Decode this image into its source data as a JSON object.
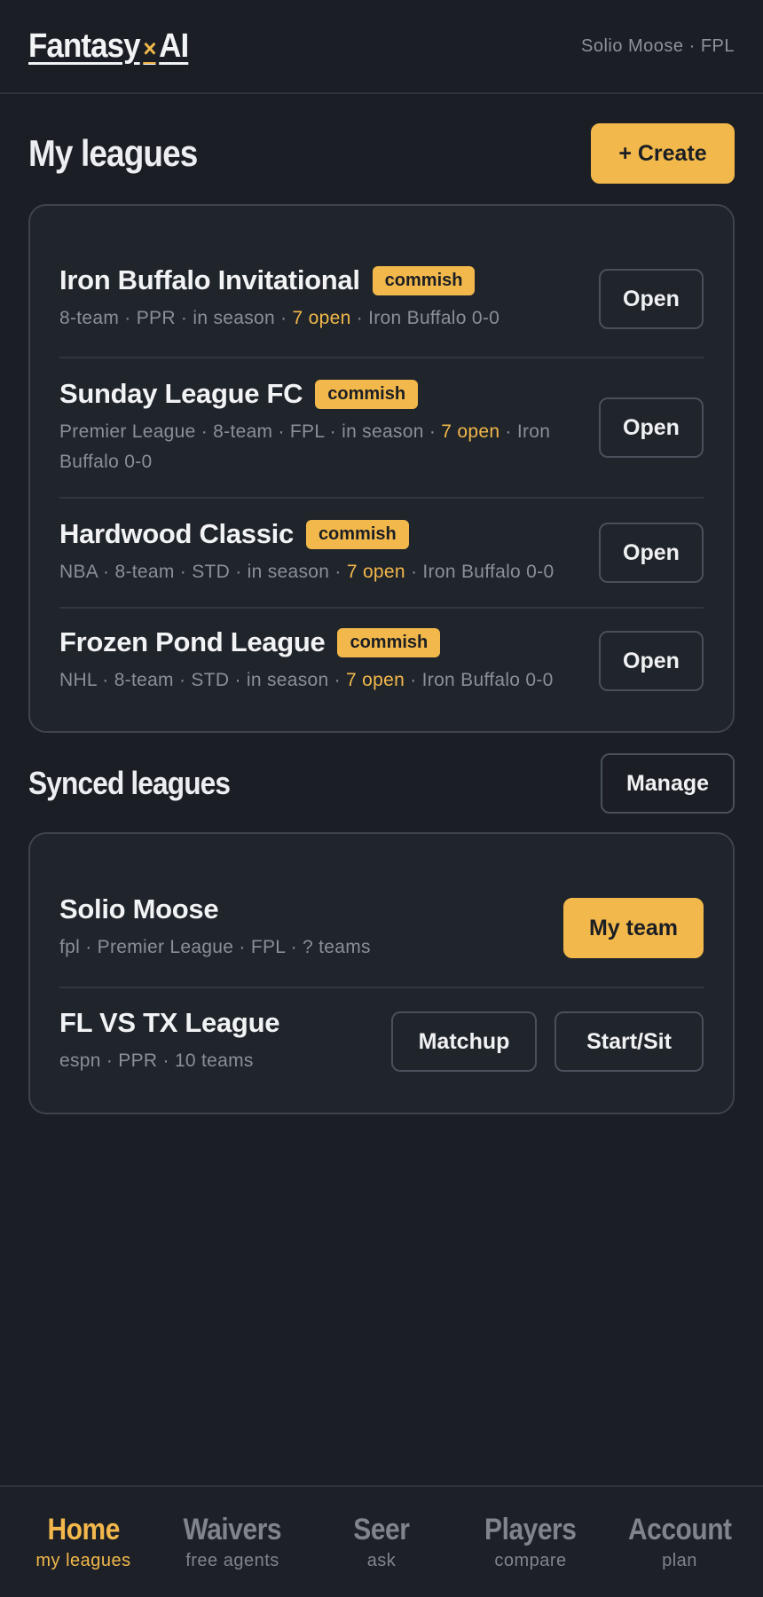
{
  "header": {
    "logo_left": "Fantasy",
    "logo_mark": "×",
    "logo_right": "AI",
    "account_meta": "Solio Moose · FPL"
  },
  "my_leagues": {
    "title": "My leagues",
    "create_label": "+ Create",
    "items": [
      {
        "name": "Iron Buffalo Invitational",
        "badge": "commish",
        "meta_before": "8-team · PPR · in season · ",
        "meta_highlight": "7 open",
        "meta_after": " · Iron Buffalo 0-0",
        "action": "Open"
      },
      {
        "name": "Sunday League FC",
        "badge": "commish",
        "meta_before": "Premier League · 8-team · FPL · in season · ",
        "meta_highlight": "7 open",
        "meta_after": " · Iron Buffalo 0-0",
        "action": "Open"
      },
      {
        "name": "Hardwood Classic",
        "badge": "commish",
        "meta_before": "NBA · 8-team · STD · in season · ",
        "meta_highlight": "7 open",
        "meta_after": " · Iron Buffalo 0-0",
        "action": "Open"
      },
      {
        "name": "Frozen Pond League",
        "badge": "commish",
        "meta_before": "NHL · 8-team · STD · in season · ",
        "meta_highlight": "7 open",
        "meta_after": " · Iron Buffalo 0-0",
        "action": "Open"
      }
    ]
  },
  "synced_leagues": {
    "title": "Synced leagues",
    "manage_label": "Manage",
    "items": [
      {
        "name": "Solio Moose",
        "meta": "fpl · Premier League · FPL · ? teams",
        "actions": [
          "My team"
        ]
      },
      {
        "name": "FL VS TX League",
        "meta": "espn · PPR · 10 teams",
        "actions": [
          "Matchup",
          "Start/Sit"
        ]
      }
    ]
  },
  "bottom_nav": [
    {
      "label": "Home",
      "sub": "my leagues",
      "active": true
    },
    {
      "label": "Waivers",
      "sub": "free agents",
      "active": false
    },
    {
      "label": "Seer",
      "sub": "ask",
      "active": false
    },
    {
      "label": "Players",
      "sub": "compare",
      "active": false
    },
    {
      "label": "Account",
      "sub": "plan",
      "active": false
    }
  ],
  "colors": {
    "background": "#1b1e24",
    "card": "#20242b",
    "accent": "#f2b84b",
    "muted_text": "#8a8f98",
    "border": "#3e434c"
  }
}
